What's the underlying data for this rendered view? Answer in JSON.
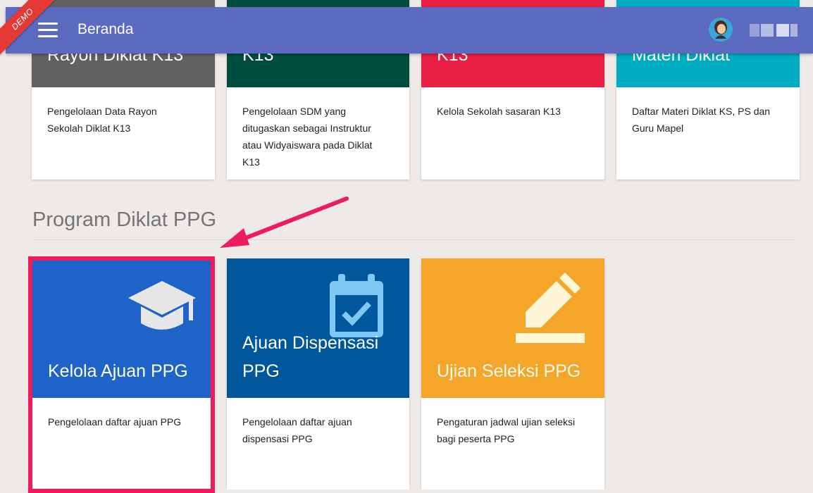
{
  "header": {
    "title": "Beranda",
    "demo_ribbon": "DEMO"
  },
  "top_cards": [
    {
      "title": "Rayon Diklat K13",
      "color": "#616161",
      "desc": "Pengelolaan Data Rayon Sekolah Diklat K13"
    },
    {
      "title": "K13",
      "color": "#004d40",
      "desc": "Pengelolaan SDM yang ditugaskan sebagai Instruktur atau Widyaiswara pada Diklat K13"
    },
    {
      "title": "K13",
      "color": "#e91e44",
      "desc": "Kelola Sekolah sasaran K13"
    },
    {
      "title": "Materi Diklat",
      "color": "#00acc1",
      "desc": "Daftar Materi Diklat KS, PS dan Guru Mapel"
    }
  ],
  "section": {
    "title": "Program Diklat PPG"
  },
  "ppg_cards": [
    {
      "title": "Kelola Ajuan PPG",
      "color": "#1e63c7",
      "icon": "graduation-cap-icon",
      "desc": "Pengelolaan daftar ajuan PPG"
    },
    {
      "title_line1": "Ajuan Dispensasi",
      "title_line2": "PPG",
      "color": "#01579b",
      "icon": "calendar-check-icon",
      "desc": "Pengelolaan daftar ajuan dispensasi PPG"
    },
    {
      "title": "Ujian Seleksi PPG",
      "color": "#f4a62a",
      "icon": "pencil-icon",
      "desc": "Pengaturan jadwal ujian seleksi bagi peserta PPG"
    }
  ]
}
